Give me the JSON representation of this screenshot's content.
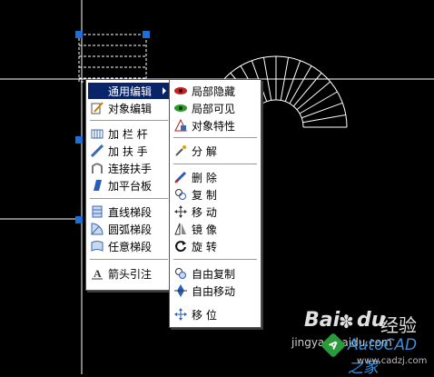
{
  "menu_primary": {
    "items": [
      {
        "label": "通用编辑",
        "icon": "none",
        "submenu": true
      },
      {
        "label": "对象编辑",
        "icon": "pencil-icon"
      },
      {
        "label": "加 栏 杆",
        "icon": "railing-icon"
      },
      {
        "label": "加 扶 手",
        "icon": "handrail-icon"
      },
      {
        "label": "连接扶手",
        "icon": "connect-handrail-icon"
      },
      {
        "label": "加平台板",
        "icon": "platform-icon"
      },
      {
        "label": "直线梯段",
        "icon": "straight-stair-icon"
      },
      {
        "label": "圆弧梯段",
        "icon": "arc-stair-icon"
      },
      {
        "label": "任意梯段",
        "icon": "free-stair-icon"
      },
      {
        "label": "箭头引注",
        "icon": "arrow-annotation-icon"
      }
    ]
  },
  "menu_submenu": {
    "items": [
      {
        "label": "局部隐藏",
        "icon": "eye-closed-icon"
      },
      {
        "label": "局部可见",
        "icon": "eye-open-icon"
      },
      {
        "label": "对象特性",
        "icon": "properties-icon"
      },
      {
        "label": "分    解",
        "icon": "explode-icon"
      },
      {
        "label": "删    除",
        "icon": "erase-icon"
      },
      {
        "label": "复    制",
        "icon": "copy-icon"
      },
      {
        "label": "移    动",
        "icon": "move-icon"
      },
      {
        "label": "镜    像",
        "icon": "mirror-icon"
      },
      {
        "label": "旋    转",
        "icon": "rotate-icon"
      },
      {
        "label": "自由复制",
        "icon": "free-copy-icon"
      },
      {
        "label": "自由移动",
        "icon": "free-move-icon"
      },
      {
        "label": "移    位",
        "icon": "shift-icon"
      }
    ]
  },
  "watermark": {
    "brand": "Bai",
    "du": "du",
    "jingyan": "经验",
    "url_partial": "jingyan.baidu.com",
    "site": "www.cadzj.com",
    "cad_logo": "AutoCAD之家"
  },
  "colors": {
    "canvas": "#000000",
    "highlight": "#0a246a",
    "grip": "#1e6fd9"
  }
}
